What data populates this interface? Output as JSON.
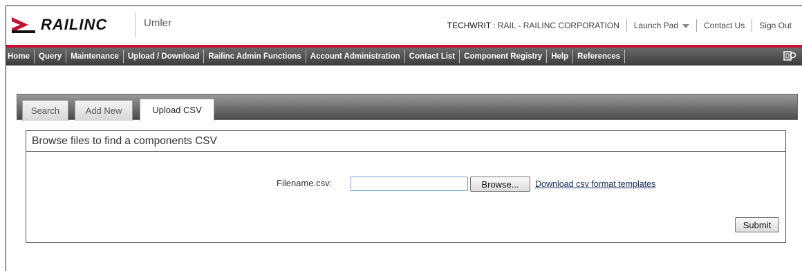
{
  "header": {
    "logo_text": "RAILINC",
    "app_name": "Umler",
    "user_id": "TECHWRIT",
    "user_org": " : RAIL - RAILINC CORPORATION",
    "launch_pad": "Launch Pad",
    "contact_us": "Contact Us",
    "sign_out": "Sign Out"
  },
  "nav": {
    "items": [
      "Home",
      "Query",
      "Maintenance",
      "Upload / Download",
      "Railinc Admin Functions",
      "Account Administration",
      "Contact List",
      "Component Registry",
      "Help",
      "References"
    ],
    "icon": "window-search-icon"
  },
  "tabs": [
    {
      "label": "Search",
      "active": false
    },
    {
      "label": "Add New",
      "active": false
    },
    {
      "label": "Upload CSV",
      "active": true
    }
  ],
  "panel": {
    "title": "Browse files to find a components CSV",
    "file_label": "Filename.csv:",
    "file_value": "",
    "browse_label": "Browse...",
    "download_link": "Download csv format templates",
    "submit_label": "Submit"
  },
  "colors": {
    "brand_red": "#c8102e",
    "nav_dark": "#3c3c3c",
    "link": "#1a2a5a"
  }
}
